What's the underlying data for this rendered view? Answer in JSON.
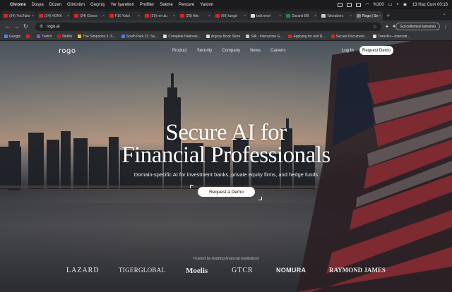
{
  "menubar": {
    "app": "Chrome",
    "items": [
      "Dosya",
      "Düzen",
      "Görünüm",
      "Geçmiş",
      "Yer İşaretleri",
      "Profiller",
      "Sekme",
      "Pencere",
      "Yardım"
    ],
    "clock": "13 Haz Cum  00:16",
    "battery": "%100"
  },
  "tabs": [
    {
      "label": "(34) YouTube",
      "color": "#e62117"
    },
    {
      "label": "(34) HONK",
      "color": "#e62117"
    },
    {
      "label": "(34) Günce",
      "color": "#e62117"
    },
    {
      "label": "F16 Yakıt",
      "color": "#e62117"
    },
    {
      "label": "(29) ne ulu",
      "color": "#e62117"
    },
    {
      "label": "(29) Aile",
      "color": "#e62117"
    },
    {
      "label": "(60) langd",
      "color": "#e62117"
    },
    {
      "label": "bolt.new/",
      "color": "#dddddd"
    },
    {
      "label": "Garanti BB",
      "color": "#1f8a3a"
    },
    {
      "label": "Takeabers",
      "color": "#cccccc"
    },
    {
      "label": "Rogo | Sec",
      "color": "#8a8a8a",
      "active": true
    }
  ],
  "toolbar": {
    "url": "rogo.ai",
    "update_label": "Güncellemeyi tamamla"
  },
  "bookmarks": [
    {
      "label": "Google",
      "color": "#4285f4"
    },
    {
      "label": "",
      "color": "#e62117"
    },
    {
      "label": "Twitch",
      "color": "#9146ff"
    },
    {
      "label": "Netflix",
      "color": "#e50914"
    },
    {
      "label": "The Simpsons 3. S...",
      "color": "#f5c518"
    },
    {
      "label": "South Park 23. Se...",
      "color": "#3b82f6"
    },
    {
      "label": "Complete National...",
      "color": "#dddddd"
    },
    {
      "label": "Argosy Book Store",
      "color": "#dddddd"
    },
    {
      "label": "Silk - Interactive G...",
      "color": "#cccccc"
    },
    {
      "label": "Applying for and R...",
      "color": "#e62117"
    },
    {
      "label": "Secure Document...",
      "color": "#e62117"
    },
    {
      "label": "Transfer—Internati...",
      "color": "#dddddd"
    }
  ],
  "site": {
    "logo": "rogo",
    "nav": [
      "Product",
      "Security",
      "Company",
      "News",
      "Careers"
    ],
    "login": "Log In",
    "request_demo": "Request Demo",
    "headline_1": "Secure AI for",
    "headline_2": "Financial Professionals",
    "subheadline": "Domain-specific AI for investment banks, private equity firms, and hedge funds",
    "cta": "Request a Demo",
    "trusted": "Trusted by leading financial institutions",
    "logos": [
      "LAZARD",
      "TIGERGLOBAL",
      "Moelis",
      "GTCR",
      "NOMURA",
      "RAYMOND JAMES"
    ]
  }
}
